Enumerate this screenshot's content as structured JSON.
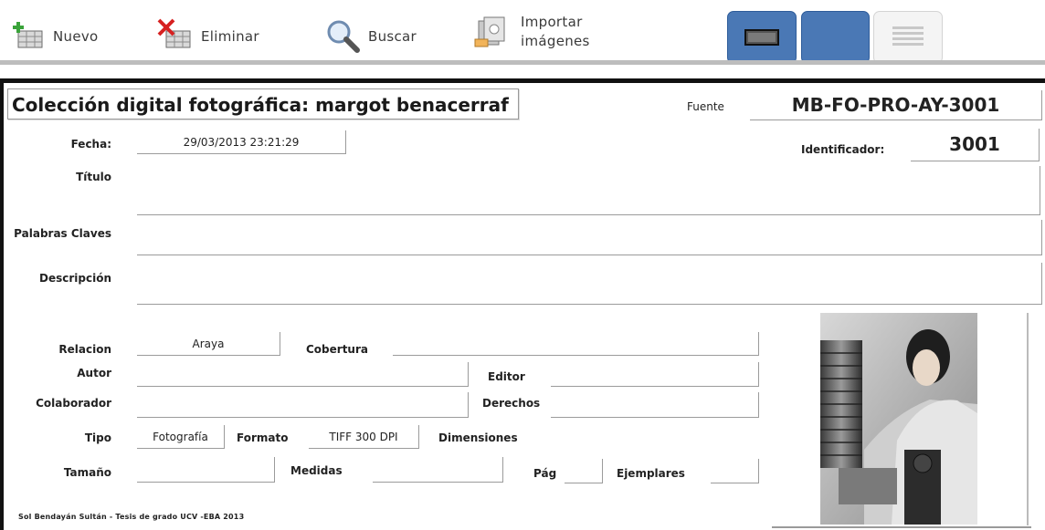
{
  "toolbar": {
    "nuevo": "Nuevo",
    "eliminar": "Eliminar",
    "buscar": "Buscar",
    "importar_line1": "Importar",
    "importar_line2": "imágenes"
  },
  "form": {
    "title": "Colección digital fotográfica: margot benacerraf",
    "fuente_label": "Fuente",
    "fuente_value": "MB-FO-PRO-AY-3001",
    "fecha_label": "Fecha:",
    "fecha_value": "29/03/2013 23:21:29",
    "identificador_label": "Identificador:",
    "identificador_value": "3001",
    "titulo_label": "Título",
    "titulo_value": "",
    "palabras_label": "Palabras Claves",
    "palabras_value": "",
    "descripcion_label": "Descripción",
    "descripcion_value": "",
    "relacion_label": "Relacion",
    "relacion_value": "Araya",
    "cobertura_label": "Cobertura",
    "cobertura_value": "",
    "autor_label": "Autor",
    "autor_value": "",
    "editor_label": "Editor",
    "editor_value": "",
    "colaborador_label": "Colaborador",
    "colaborador_value": "",
    "derechos_label": "Derechos",
    "derechos_value": "",
    "tipo_label": "Tipo",
    "tipo_value": "Fotografía",
    "formato_label": "Formato",
    "formato_value": "TIFF 300 DPI",
    "dimensiones_label": "Dimensiones",
    "tamano_label": "Tamaño",
    "tamano_value": "",
    "medidas_label": "Medidas",
    "medidas_value": "",
    "pag_label": "Pág",
    "pag_value": "",
    "ejemplares_label": "Ejemplares",
    "ejemplares_value": ""
  },
  "footer": "Sol Bendayán Sultán - Tesis de grado UCV -EBA 2013",
  "icons": {
    "nuevo": "add-record-icon",
    "eliminar": "delete-record-icon",
    "buscar": "magnifier-icon",
    "importar": "import-images-icon",
    "view1": "form-view-icon",
    "view2": "blank-view-icon",
    "view3": "list-view-icon"
  },
  "colors": {
    "view_button": "#4a78b5",
    "add_accent": "#3aa33a",
    "delete_accent": "#d62020"
  }
}
